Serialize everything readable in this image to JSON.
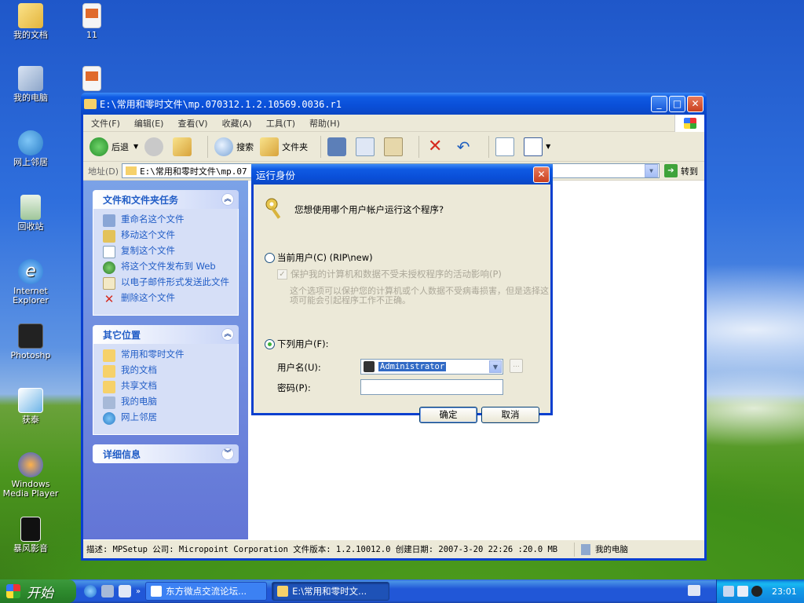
{
  "desktop": {
    "icons": [
      "我的文档",
      "11",
      "我的电脑",
      "网上邻居",
      "回收站",
      "Internet Explorer",
      "Photoshp",
      "获泰",
      "Windows Media Player",
      "暴风影音"
    ]
  },
  "explorer": {
    "title": "E:\\常用和零时文件\\mp.070312.1.2.10569.0036.r1",
    "menu": [
      "文件(F)",
      "编辑(E)",
      "查看(V)",
      "收藏(A)",
      "工具(T)",
      "帮助(H)"
    ],
    "toolbar": {
      "back": "后退",
      "search": "搜索",
      "folders": "文件夹"
    },
    "address": {
      "label": "地址(D)",
      "value": "E:\\常用和零时文件\\mp.07",
      "go": "转到"
    },
    "panels": {
      "tasks": {
        "title": "文件和文件夹任务",
        "items": [
          "重命名这个文件",
          "移动这个文件",
          "复制这个文件",
          "将这个文件发布到 Web",
          "以电子邮件形式发送此文件",
          "删除这个文件"
        ]
      },
      "places": {
        "title": "其它位置",
        "items": [
          "常用和零时文件",
          "我的文档",
          "共享文档",
          "我的电脑",
          "网上邻居"
        ]
      },
      "details": {
        "title": "详细信息"
      }
    },
    "status": {
      "text": "描述: MPSetup 公司: Micropoint Corporation 文件版本: 1.2.10012.0 创建日期: 2007-3-20 22:26 :20.0 MB",
      "location": "我的电脑"
    }
  },
  "runas": {
    "title": "运行身份",
    "question": "您想使用哪个用户帐户运行这个程序?",
    "current_user": "当前用户(C) (RIP\\new)",
    "protect": "保护我的计算机和数据不受未授权程序的活动影响(P)",
    "note": "这个选项可以保护您的计算机或个人数据不受病毒损害，但是选择这项可能会引起程序工作不正确。",
    "following_user": "下列用户(F):",
    "username_label": "用户名(U):",
    "username_value": "Administrator",
    "password_label": "密码(P):",
    "browse": "...",
    "ok": "确定",
    "cancel": "取消"
  },
  "taskbar": {
    "start": "开始",
    "task1": "东方微点交流论坛...",
    "task2": "E:\\常用和零时文...",
    "clock": "23:01",
    "more": "»"
  }
}
